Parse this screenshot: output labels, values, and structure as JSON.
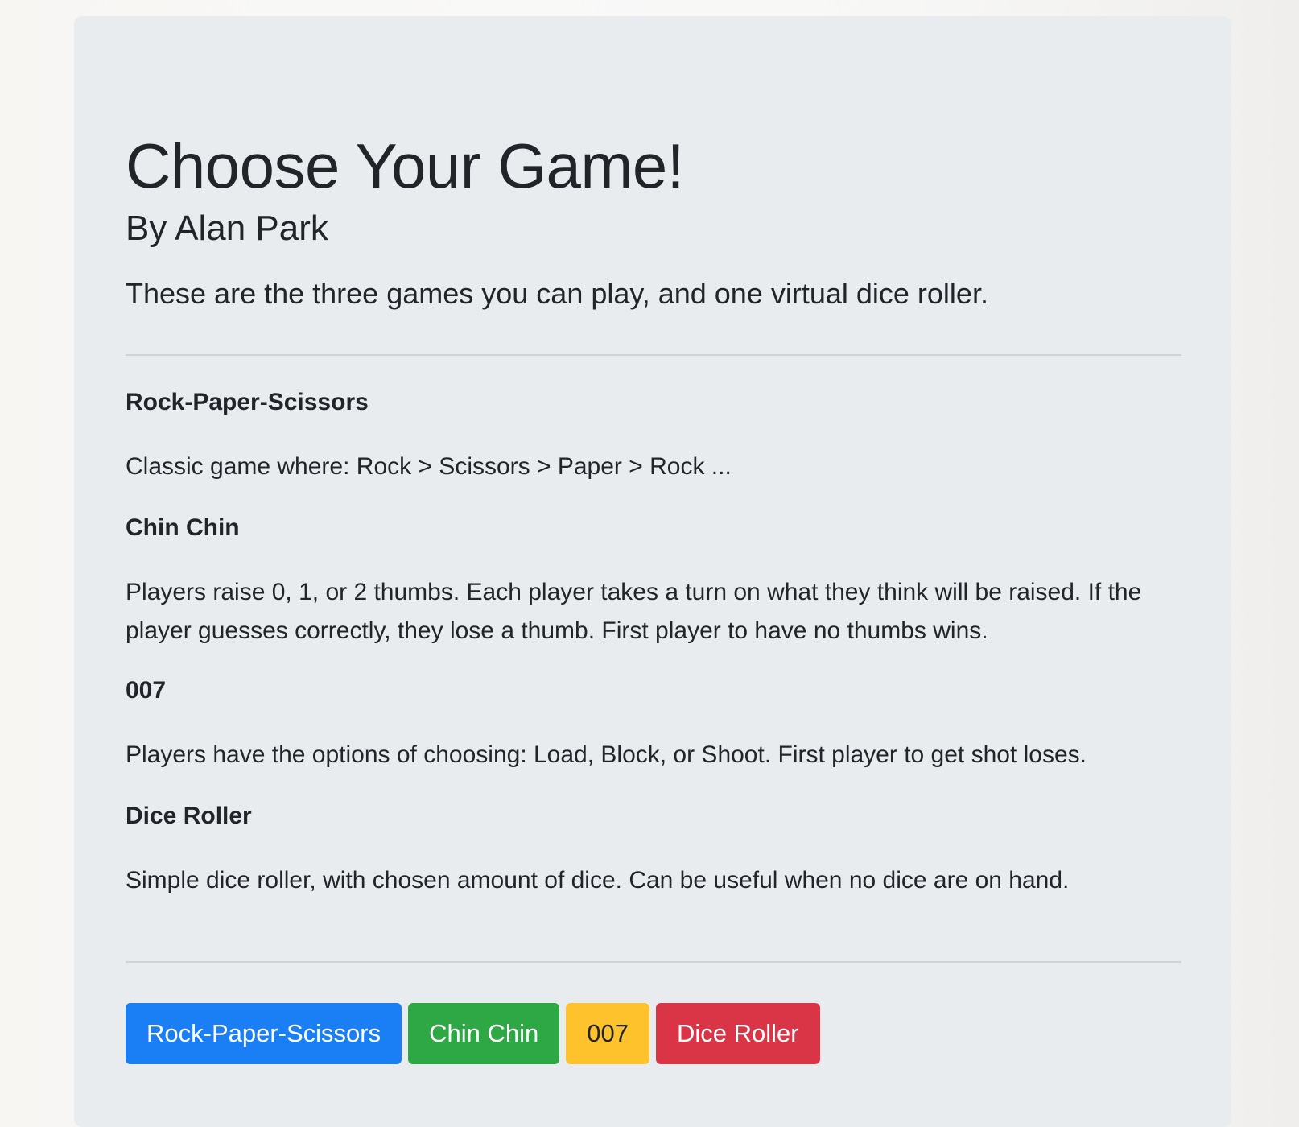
{
  "header": {
    "title": "Choose Your Game!",
    "subtitle": "By Alan Park",
    "lead": "These are the three games you can play, and one virtual dice roller."
  },
  "games": [
    {
      "name": "Rock-Paper-Scissors",
      "description": "Classic game where: Rock > Scissors > Paper > Rock ..."
    },
    {
      "name": "Chin Chin",
      "description": "Players raise 0, 1, or 2 thumbs. Each player takes a turn on what they think will be raised. If the player guesses correctly, they lose a thumb. First player to have no thumbs wins."
    },
    {
      "name": "007",
      "description": "Players have the options of choosing: Load, Block, or Shoot. First player to get shot loses."
    },
    {
      "name": "Dice Roller",
      "description": "Simple dice roller, with chosen amount of dice. Can be useful when no dice are on hand."
    }
  ],
  "buttons": [
    {
      "label": "Rock-Paper-Scissors",
      "color": "#1a7ff5"
    },
    {
      "label": "Chin Chin",
      "color": "#2ea745"
    },
    {
      "label": "007",
      "color": "#fdc22c"
    },
    {
      "label": "Dice Roller",
      "color": "#da3547"
    }
  ]
}
